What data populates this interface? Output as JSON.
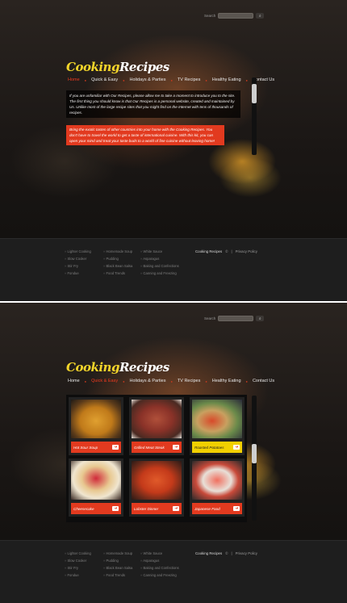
{
  "search": {
    "label": "Search",
    "placeholder": "",
    "button_icon": "search-icon"
  },
  "logo": {
    "part1": "Cooking",
    "part2": "Recipes"
  },
  "nav": {
    "items": [
      "Home",
      "Quick & Easy",
      "Holidays & Parties",
      "TV Recipes",
      "Healthy Eating",
      "Contact Us"
    ]
  },
  "intro": {
    "para1": "If you are unfamiliar with Our Recipes, please allow me to take a moment to introduce you to the site. The first thing you should know is that Our Recipes is a personal website, created and maintained by Us. Unlike most of the large recipe sites that you might find on the Internet with tens of thousands of recipes.",
    "para2": "Bring the exotic tastes of other countries into your home with the Cooking Recipes. You don't have to travel the world to get a taste of international cuisine. With this kit, you can open your mind and treat your taste buds to a world of fine cuisine without leaving home!"
  },
  "footer": {
    "col1": [
      "Lighter Cooking",
      "Slow Cooker",
      "Stir Fry",
      "Fondue"
    ],
    "col2": [
      "Homemade Soup",
      "Pudding",
      "Black Bean Salsa",
      "Food Trends"
    ],
    "col3": [
      "White Sauce",
      "Asparagus",
      "Baking and Confections",
      "Canning and Freezing"
    ],
    "link1": "Cooking Recipes",
    "copy": "©",
    "sep": "|",
    "link2": "Privacy Policy"
  },
  "gallery": {
    "items": [
      {
        "label": "Hot Sour Soup"
      },
      {
        "label": "Grilled Meat Steak"
      },
      {
        "label": "Roasted Potatoes"
      },
      {
        "label": "Cheesecake"
      },
      {
        "label": "Lobster Dinner"
      },
      {
        "label": "Japanese Food"
      }
    ],
    "selected_index": 2
  },
  "colors": {
    "accent": "#e23a1f",
    "logo_yellow": "#f4d62a",
    "selected_caption": "#f2d000"
  }
}
